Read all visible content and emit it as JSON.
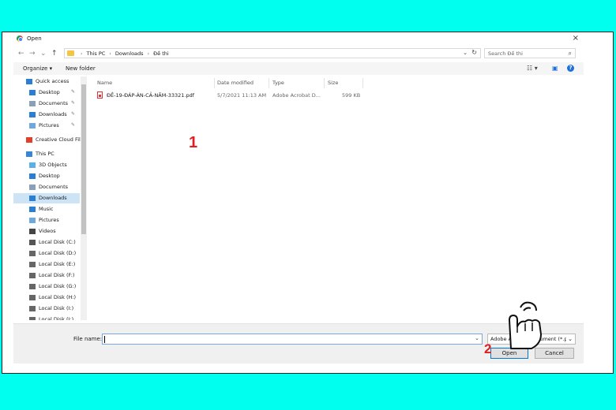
{
  "dialog": {
    "title": "Open",
    "close_glyph": "×"
  },
  "nav": {
    "back": "←",
    "forward": "→",
    "recent": "⌄",
    "up": "↑",
    "breadcrumbs": [
      "This PC",
      "Downloads",
      "Đề thi"
    ],
    "breadcrumb_sep": "›",
    "dropdown_glyph": "⌄",
    "refresh_glyph": "↻",
    "search_placeholder": "Search Đề thi",
    "search_glyph": "⌕"
  },
  "toolbar": {
    "organize": "Organize ▾",
    "new_folder": "New folder",
    "view_glyph": "☷ ▾",
    "pane_glyph": "▣",
    "help_glyph": "?"
  },
  "sidebar": {
    "items": [
      {
        "label": "Quick access",
        "icon": "star-icon",
        "pinned": false,
        "selected": false
      },
      {
        "label": "Desktop",
        "icon": "desktop-icon",
        "pinned": true,
        "selected": false
      },
      {
        "label": "Documents",
        "icon": "documents-icon",
        "pinned": true,
        "selected": false
      },
      {
        "label": "Downloads",
        "icon": "download-icon",
        "pinned": true,
        "selected": false
      },
      {
        "label": "Pictures",
        "icon": "pictures-icon",
        "pinned": true,
        "selected": false
      },
      {
        "label": "Creative Cloud Fil",
        "icon": "creative-cloud-icon",
        "pinned": false,
        "selected": false
      },
      {
        "label": "This PC",
        "icon": "computer-icon",
        "pinned": false,
        "selected": false
      },
      {
        "label": "3D Objects",
        "icon": "cube-icon",
        "pinned": false,
        "selected": false
      },
      {
        "label": "Desktop",
        "icon": "desktop-icon",
        "pinned": false,
        "selected": false
      },
      {
        "label": "Documents",
        "icon": "documents-icon",
        "pinned": false,
        "selected": false
      },
      {
        "label": "Downloads",
        "icon": "download-icon",
        "pinned": false,
        "selected": true
      },
      {
        "label": "Music",
        "icon": "music-icon",
        "pinned": false,
        "selected": false
      },
      {
        "label": "Pictures",
        "icon": "pictures-icon",
        "pinned": false,
        "selected": false
      },
      {
        "label": "Videos",
        "icon": "video-icon",
        "pinned": false,
        "selected": false
      },
      {
        "label": "Local Disk (C:)",
        "icon": "system-drive-icon",
        "pinned": false,
        "selected": false
      },
      {
        "label": "Local Disk (D:)",
        "icon": "drive-icon",
        "pinned": false,
        "selected": false
      },
      {
        "label": "Local Disk (E:)",
        "icon": "drive-icon",
        "pinned": false,
        "selected": false
      },
      {
        "label": "Local Disk (F:)",
        "icon": "drive-icon",
        "pinned": false,
        "selected": false
      },
      {
        "label": "Local Disk (G:)",
        "icon": "drive-icon",
        "pinned": false,
        "selected": false
      },
      {
        "label": "Local Disk (H:)",
        "icon": "drive-icon",
        "pinned": false,
        "selected": false
      },
      {
        "label": "Local Disk (I:)",
        "icon": "drive-icon",
        "pinned": false,
        "selected": false
      },
      {
        "label": "Local Disk (J:)",
        "icon": "drive-icon",
        "pinned": false,
        "selected": false
      }
    ],
    "pin_glyph": "✎"
  },
  "columns": {
    "name": "Name",
    "date": "Date modified",
    "type": "Type",
    "size": "Size"
  },
  "files": [
    {
      "name": "ĐỀ-19-ĐÁP-ÁN-CẢ-NĂM-33321.pdf",
      "date": "5/7/2021 11:13 AM",
      "type": "Adobe Acrobat D...",
      "size": "599 KB"
    }
  ],
  "annotations": {
    "step1": "1",
    "step2": "2"
  },
  "bottom": {
    "file_name_label": "File name:",
    "file_name_value": "",
    "dropdown_glyph": "⌄",
    "file_type": "Adobe Acrobat Document (*.pdf)",
    "open_label": "Open",
    "cancel_label": "Cancel"
  },
  "colors": {
    "background": "#00ffee",
    "accent": "#0078d7",
    "selection": "#cde4f7",
    "marker": "#e02020"
  }
}
